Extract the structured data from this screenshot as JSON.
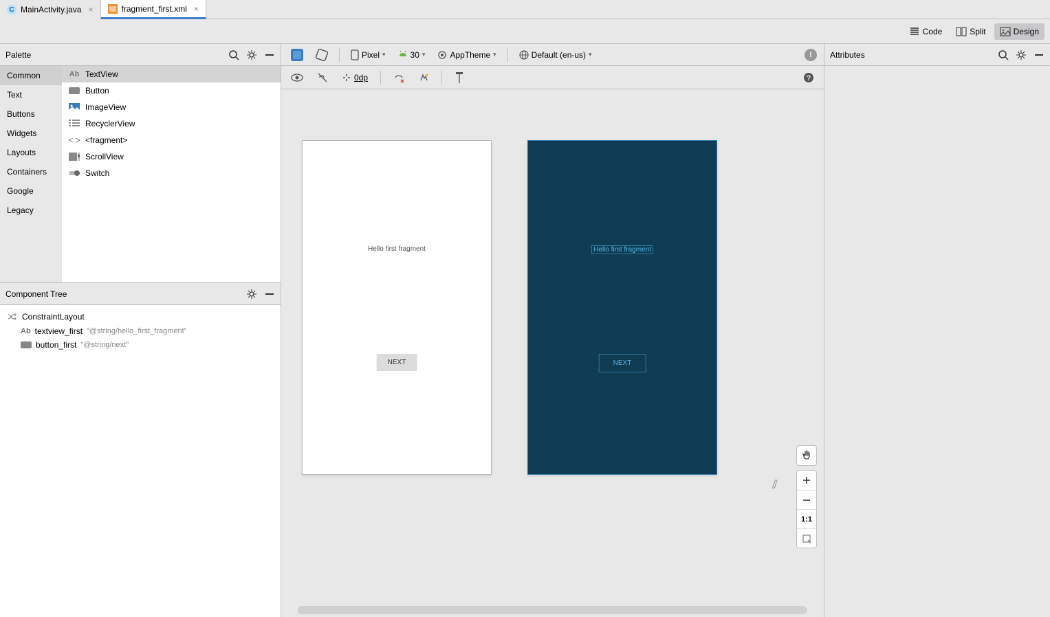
{
  "tabs": [
    {
      "label": "MainActivity.java",
      "icon": "c"
    },
    {
      "label": "fragment_first.xml",
      "icon": "xml"
    }
  ],
  "view_modes": {
    "code": "Code",
    "split": "Split",
    "design": "Design"
  },
  "palette": {
    "title": "Palette",
    "categories": [
      "Common",
      "Text",
      "Buttons",
      "Widgets",
      "Layouts",
      "Containers",
      "Google",
      "Legacy"
    ],
    "items": [
      "TextView",
      "Button",
      "ImageView",
      "RecyclerView",
      "<fragment>",
      "ScrollView",
      "Switch"
    ]
  },
  "tree": {
    "title": "Component Tree",
    "root": "ConstraintLayout",
    "children": [
      {
        "name": "textview_first",
        "attr": "\"@string/hello_first_fragment\""
      },
      {
        "name": "button_first",
        "attr": "\"@string/next\""
      }
    ]
  },
  "attributes": {
    "title": "Attributes"
  },
  "toolbar": {
    "device": "Pixel",
    "api": "30",
    "theme": "AppTheme",
    "locale": "Default (en-us)",
    "margin": "0dp"
  },
  "preview": {
    "text": "Hello first fragment",
    "button": "NEXT"
  },
  "zoom": {
    "reset": "1:1"
  }
}
